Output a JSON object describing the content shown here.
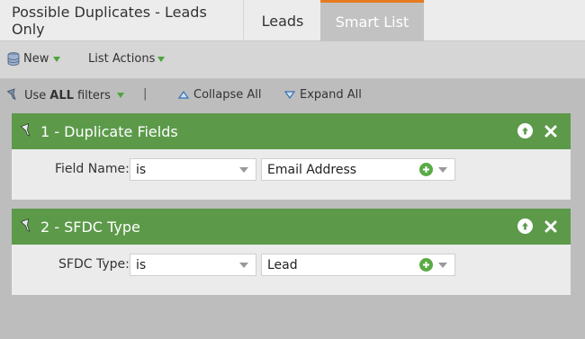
{
  "tabs": [
    {
      "label": "Possible Duplicates - Leads Only"
    },
    {
      "label": "Leads"
    },
    {
      "label": "Smart List"
    }
  ],
  "toolbar": {
    "new_label": "New",
    "list_actions_label": "List Actions"
  },
  "filterbar": {
    "use_prefix": "Use",
    "use_bold": "ALL",
    "use_suffix": "filters",
    "separator": "|",
    "collapse_label": "Collapse All",
    "expand_label": "Expand All"
  },
  "filters": [
    {
      "title": "1 - Duplicate Fields",
      "field_label": "Field Name:",
      "operator": "is",
      "value": "Email Address"
    },
    {
      "title": "2 - SFDC Type",
      "field_label": "SFDC Type:",
      "operator": "is",
      "value": "Lead"
    }
  ],
  "colors": {
    "accent_tab": "#e67a1e",
    "filter_header": "#5c9a4a",
    "add_button": "#5aaa45"
  }
}
